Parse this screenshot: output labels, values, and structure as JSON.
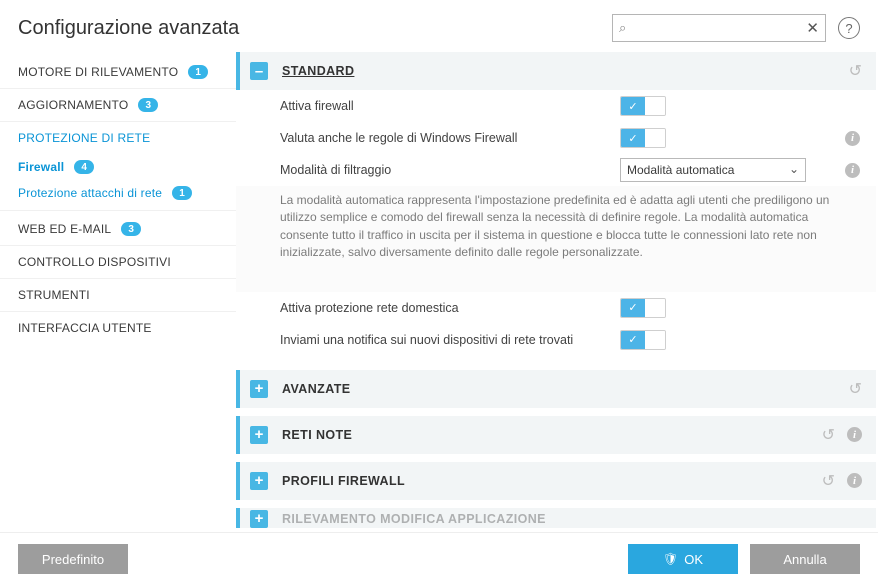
{
  "header": {
    "title": "Configurazione avanzata",
    "search_placeholder": "",
    "clear_glyph": "✕",
    "help_glyph": "?"
  },
  "sidebar": {
    "items": [
      {
        "label": "MOTORE DI RILEVAMENTO",
        "badge": "1"
      },
      {
        "label": "AGGIORNAMENTO",
        "badge": "3"
      },
      {
        "label": "PROTEZIONE DI RETE",
        "badge": ""
      },
      {
        "label": "Firewall",
        "badge": "4"
      },
      {
        "label": "Protezione attacchi di rete",
        "badge": "1"
      },
      {
        "label": "WEB ED E-MAIL",
        "badge": "3"
      },
      {
        "label": "CONTROLLO DISPOSITIVI",
        "badge": ""
      },
      {
        "label": "STRUMENTI",
        "badge": ""
      },
      {
        "label": "INTERFACCIA UTENTE",
        "badge": ""
      }
    ]
  },
  "sections": {
    "standard": {
      "title": "STANDARD",
      "exp": "–",
      "rows": {
        "r0": "Attiva firewall",
        "r1": "Valuta anche le regole di Windows Firewall",
        "r2_label": "Modalità di filtraggio",
        "r2_value": "Modalità automatica",
        "desc": "La modalità automatica rappresenta l'impostazione predefinita ed è adatta agli utenti che prediligono un utilizzo semplice e comodo del firewall senza la necessità di definire regole. La modalità automatica consente tutto il traffico in uscita per il sistema in questione e blocca tutte le connessioni lato rete non inizializzate, salvo diversamente definito dalle regole personalizzate.",
        "r3": "Attiva protezione rete domestica",
        "r4": "Inviami una notifica sui nuovi dispositivi di rete trovati"
      }
    },
    "avanzate": {
      "title": "AVANZATE",
      "exp": "+"
    },
    "reti": {
      "title": "RETI NOTE",
      "exp": "+"
    },
    "profili": {
      "title": "PROFILI FIREWALL",
      "exp": "+"
    },
    "rilev": {
      "title": "RILEVAMENTO MODIFICA APPLICAZIONE",
      "exp": "+"
    }
  },
  "glyphs": {
    "undo": "↺",
    "info": "i",
    "check": "✓",
    "chev": "⌄",
    "mag": "⌕",
    "shield": "🛡"
  },
  "footer": {
    "default": "Predefinito",
    "ok": "OK",
    "cancel": "Annulla"
  }
}
